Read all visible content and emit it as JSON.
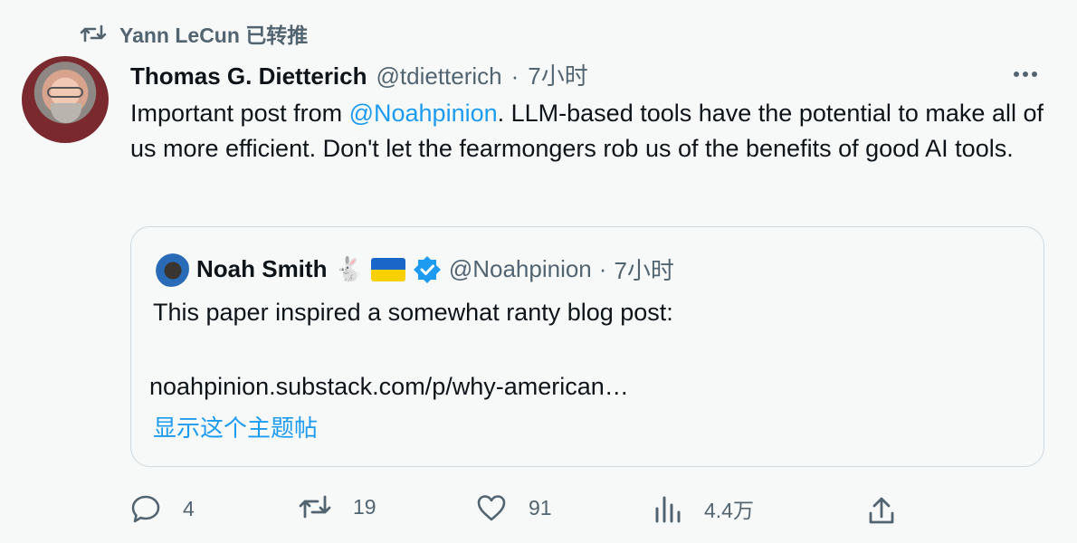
{
  "retweet": {
    "text": "Yann LeCun 已转推",
    "icon": "retweet-icon"
  },
  "tweet": {
    "author_name": "Thomas G. Dietterich",
    "author_handle": "@tdietterich",
    "separator": "·",
    "time": "7小时",
    "text_before": "Important post from ",
    "mention": "@Noahpinion",
    "text_after": ". LLM-based tools have the potential to make all of us more efficient. Don't let the fearmongers rob us of the benefits of good AI tools."
  },
  "quote": {
    "author_name": "Noah Smith",
    "emoji": "🐇",
    "author_handle": "@Noahpinion",
    "separator": "·",
    "time": "7小时",
    "text": "This paper inspired a somewhat ranty blog post:",
    "link": "noahpinion.substack.com/p/why-american…",
    "show_thread": "显示这个主题帖"
  },
  "actions": {
    "reply_count": "4",
    "retweet_count": "19",
    "like_count": "91",
    "views_count": "4.4万"
  },
  "colors": {
    "accent": "#1d9bf0",
    "muted": "#536471",
    "background": "#f7f9f9",
    "verified": "#1d9bf0"
  }
}
